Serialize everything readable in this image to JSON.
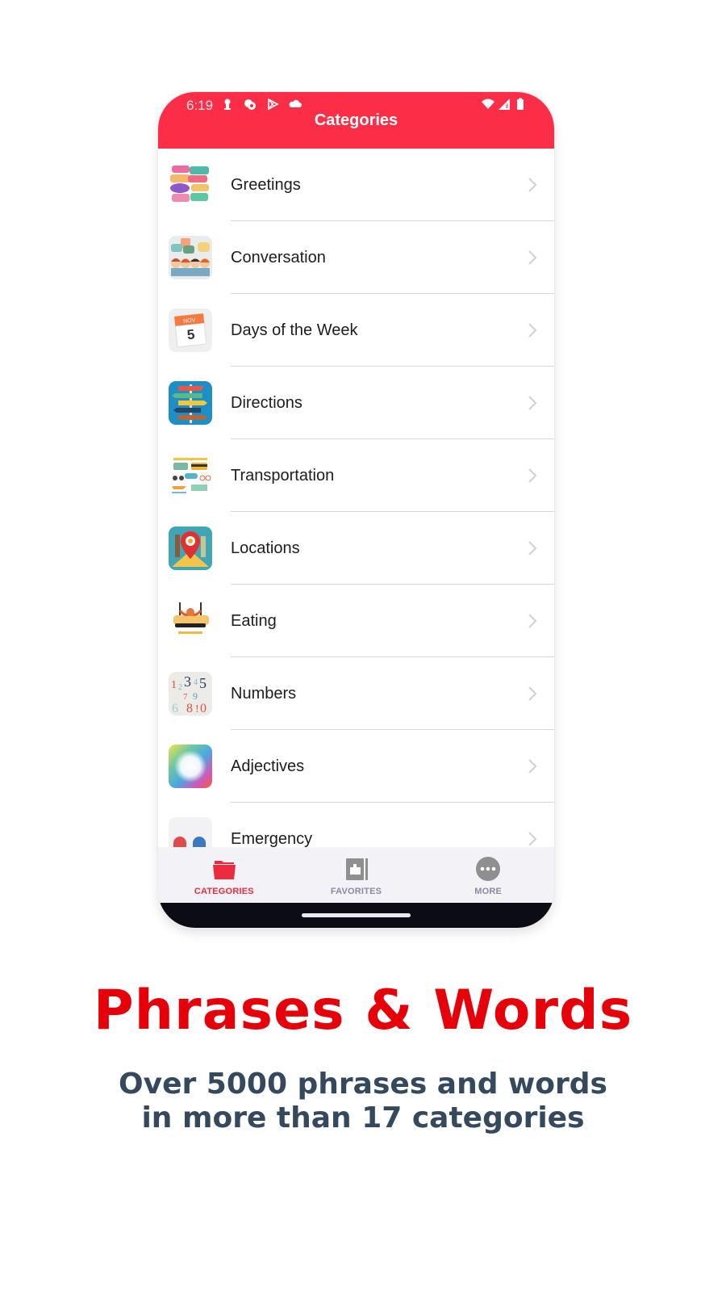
{
  "status_bar": {
    "time": "6:19",
    "left_icons": [
      "keyhole-notification-icon",
      "chat-bubble-notification-icon",
      "play-store-icon",
      "cloud-icon"
    ],
    "right_icons": [
      "wifi-icon",
      "signal-icon",
      "battery-icon"
    ]
  },
  "app_bar": {
    "title": "Categories"
  },
  "categories": [
    {
      "label": "Greetings",
      "icon": "greetings-thumbnail"
    },
    {
      "label": "Conversation",
      "icon": "conversation-thumbnail"
    },
    {
      "label": "Days of the Week",
      "icon": "calendar-thumbnail",
      "calendar_month": "NOV",
      "calendar_day": "5"
    },
    {
      "label": "Directions",
      "icon": "signpost-thumbnail"
    },
    {
      "label": "Transportation",
      "icon": "vehicles-thumbnail"
    },
    {
      "label": "Locations",
      "icon": "map-pin-thumbnail"
    },
    {
      "label": "Eating",
      "icon": "eating-thumbnail"
    },
    {
      "label": "Numbers",
      "icon": "numbers-thumbnail",
      "digits": "12345 7 9 8!0"
    },
    {
      "label": "Adjectives",
      "icon": "rainbow-thumbnail"
    },
    {
      "label": "Emergency",
      "icon": "siren-thumbnail"
    }
  ],
  "tab_bar": {
    "tabs": [
      {
        "label": "CATEGORIES",
        "icon": "folder-icon",
        "active": true
      },
      {
        "label": "FAVORITES",
        "icon": "favorites-book-icon",
        "active": false
      },
      {
        "label": "MORE",
        "icon": "more-dots-icon",
        "active": false
      }
    ]
  },
  "promo": {
    "headline": "Phrases & Words",
    "subline_1": "Over 5000 phrases and words",
    "subline_2": "in more than 17 categories"
  },
  "colors": {
    "app_bar": "#fc2d46",
    "active_tab": "#ee2b3e",
    "inactive_tab": "#8a8aa0",
    "headline": "#e6000a",
    "subline": "#34495e"
  }
}
